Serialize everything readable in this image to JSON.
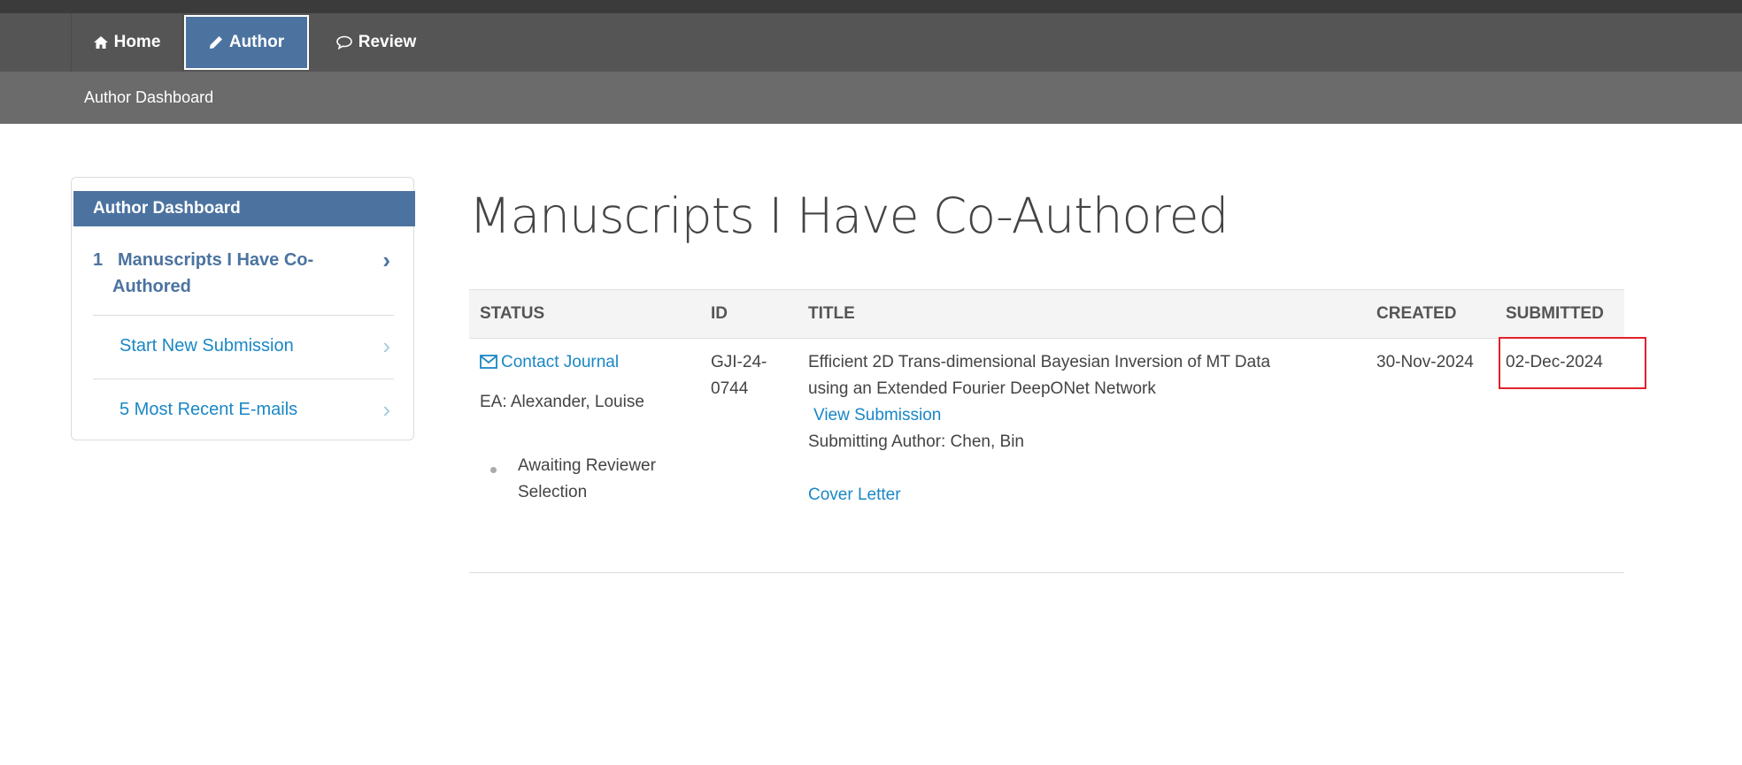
{
  "nav": {
    "tabs": [
      {
        "label": "Home",
        "icon": "home-icon"
      },
      {
        "label": "Author",
        "icon": "pencil-icon"
      },
      {
        "label": "Review",
        "icon": "comment-icon"
      }
    ]
  },
  "subnav": {
    "crumb": "Author Dashboard"
  },
  "sidebar": {
    "header": "Author Dashboard",
    "items": [
      {
        "count": "1",
        "label_line1": "Manuscripts I Have Co-",
        "label_line2": "Authored"
      },
      {
        "label": "Start New Submission"
      },
      {
        "label": "5 Most Recent E-mails"
      }
    ]
  },
  "main": {
    "title": "Manuscripts I Have Co-Authored",
    "columns": [
      "STATUS",
      "ID",
      "TITLE",
      "CREATED",
      "SUBMITTED"
    ],
    "row": {
      "contact": "Contact Journal",
      "ea": "EA: Alexander, Louise",
      "status_line1": "Awaiting Reviewer",
      "status_line2": "Selection",
      "id_line1": "GJI-24-",
      "id_line2": "0744",
      "title_line1": "Efficient 2D Trans-dimensional Bayesian Inversion of MT Data",
      "title_line2": "using an Extended Fourier DeepONet Network",
      "view_submission": "View Submission",
      "submitting_author": "Submitting Author: Chen, Bin",
      "cover_letter": "Cover Letter",
      "created": "30-Nov-2024",
      "submitted": "02-Dec-2024"
    }
  },
  "colors": {
    "accent": "#4c73a0",
    "link": "#1a87c5",
    "highlight": "#e0222b",
    "navbar": "#555555",
    "subnav": "#6b6b6b"
  }
}
